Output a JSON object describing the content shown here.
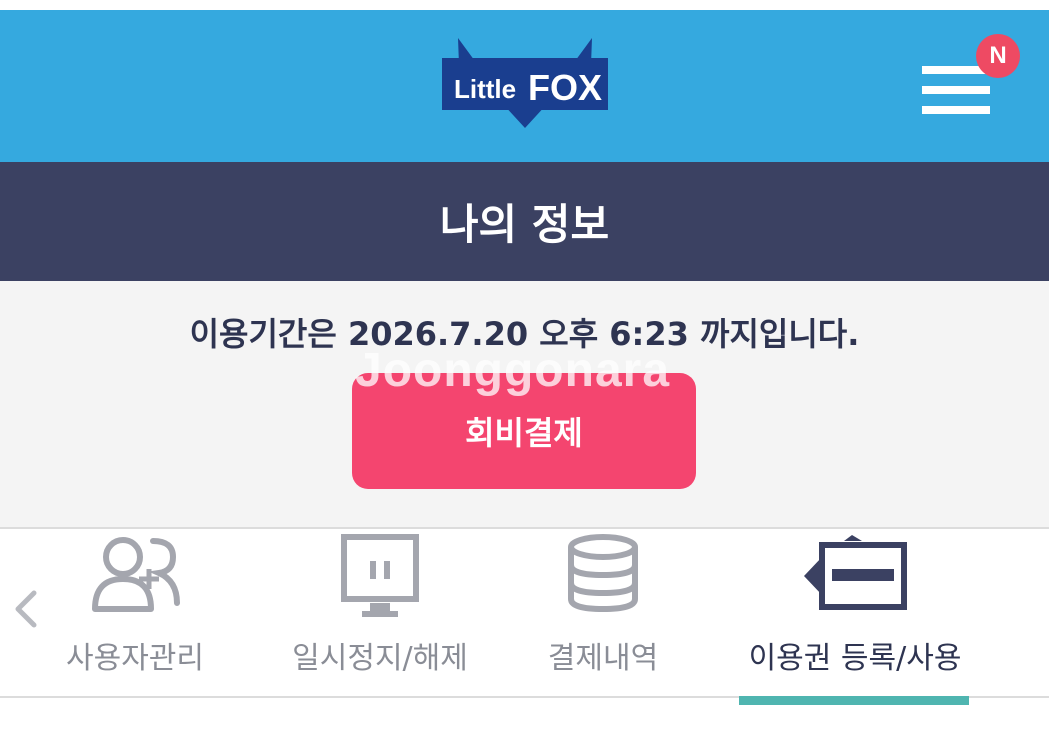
{
  "header": {
    "logo_text_little": "Little",
    "logo_text_fox": "FOX",
    "menu_icon": "hamburger-menu-icon",
    "notification_badge": "N"
  },
  "title_bar": {
    "title": "나의 정보"
  },
  "membership": {
    "period_text": "이용기간은 2026.7.20 오후 6:23 까지입니다.",
    "pay_button_label": "회비결제",
    "watermark": "Joonggonara"
  },
  "tabs": [
    {
      "label": "사용자관리",
      "icon": "add-user-icon",
      "active": false
    },
    {
      "label": "일시정지/해제",
      "icon": "pause-monitor-icon",
      "active": false
    },
    {
      "label": "결제내역",
      "icon": "database-icon",
      "active": false
    },
    {
      "label": "이용권 등록/사용",
      "icon": "ticket-card-icon",
      "active": true
    }
  ],
  "colors": {
    "header_bg": "#35a9df",
    "title_bar_bg": "#3b4162",
    "pay_button_bg": "#f4456f",
    "badge_bg": "#ee4a63",
    "active_tab_indicator": "#4fb5b0",
    "logo_navy": "#1a3e8f"
  }
}
